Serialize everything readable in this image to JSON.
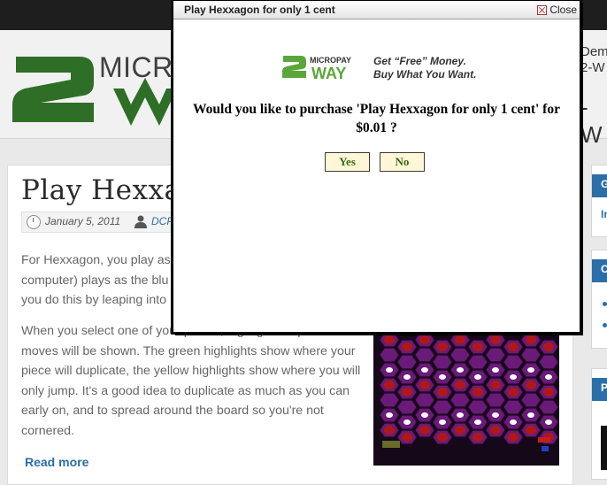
{
  "header": {
    "logo_text": "MICRO",
    "right_fragment_1": "Dem",
    "right_fragment_2": "2-W",
    "right_fragment_3": "-W"
  },
  "post": {
    "title": "Play Hexxa",
    "date": "January 5, 2011",
    "author": "DCP",
    "para1": "For Hexxagon, you play as computer) plays as the blu you do this by leaping into",
    "para2": "When you select one of your pieces, highlights of possible moves will be shown. The green highlights show where your piece will duplicate, the yellow highlights show where you will only jump. It's a good idea to duplicate as much as you can early on, and to spread around the board so you're not cornered.",
    "read_more": "Read more"
  },
  "sidebar": {
    "widget1_fragment": "G",
    "widget1_link_fragment": "In",
    "widget2_fragment": "C",
    "widget3_fragment": "P"
  },
  "dialog": {
    "title": "Play Hexxagon for only 1 cent",
    "close_label": "Close",
    "logo_micropay": "MICROPAY",
    "logo_way": "WAY",
    "tagline_1": "Get “Free” Money.",
    "tagline_2": "Buy What You Want.",
    "question": "Would you like to purchase 'Play Hexxagon for only 1 cent' for $0.01 ?",
    "yes_label": "Yes",
    "no_label": "No"
  },
  "colors": {
    "brand_green": "#3a7a2a",
    "link_blue": "#2b6ea8",
    "button_bg": "#fff7d8",
    "button_text": "#3a6a1a"
  },
  "icons": [
    "clock-icon",
    "user-icon",
    "close-icon"
  ]
}
